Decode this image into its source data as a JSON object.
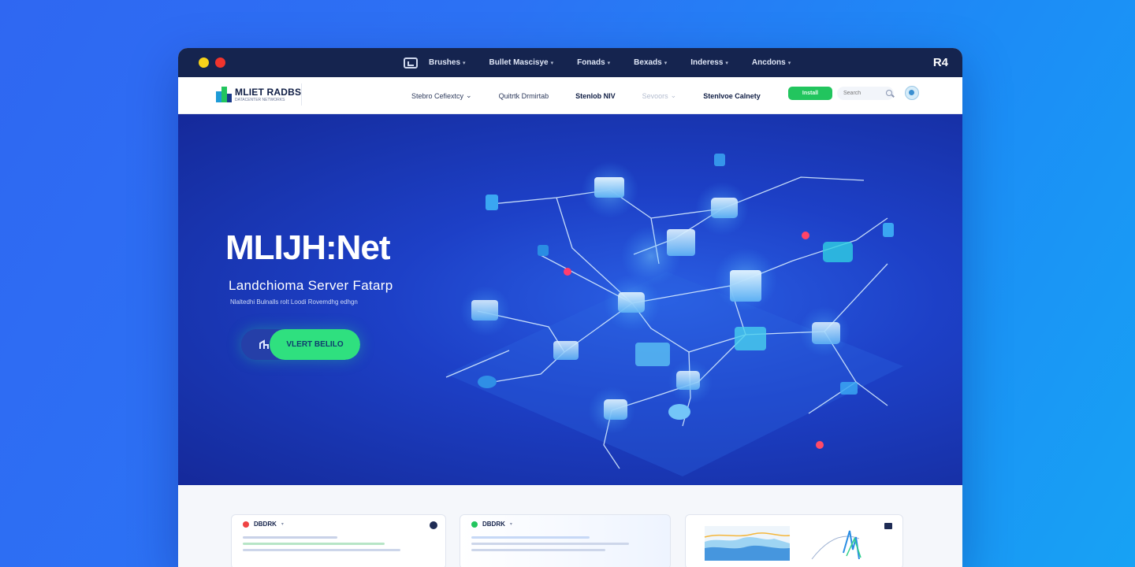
{
  "window": {
    "dots": [
      {
        "color": "#f7d21a"
      },
      {
        "color": "#f0342d"
      }
    ],
    "menu": [
      "Brushes",
      "Bullet Mascisye",
      "Fonads",
      "Bexads",
      "Inderess",
      "Ancdons"
    ],
    "right_label": "R4"
  },
  "navbar": {
    "logo_title": "MLIET RADBS",
    "logo_subtitle": "DATACENTER NETWORKS",
    "links": [
      {
        "label": "Stebro Cefiextcy",
        "chevron": "⌄"
      },
      {
        "label": "Quitrtk Drmirtab",
        "chevron": ""
      },
      {
        "label": "Stenlob NIV",
        "chevron": ""
      },
      {
        "label": "Sevoors",
        "chevron": "⌄"
      },
      {
        "label": "Stenlvoe Calnety",
        "chevron": ""
      }
    ],
    "cta_label": "Install",
    "search_placeholder": "Search"
  },
  "hero": {
    "title": "MLIJH:Net",
    "subtitle": "Landchioma Server Fatarp",
    "note": "Nlaltedhi Bulnalls rolt Loodi Rovemdhg edhgn",
    "button_label": "VLERT BELILO"
  },
  "cards": [
    {
      "title": "DBDRK",
      "status_color": "#ef4444"
    },
    {
      "title": "DBDRK",
      "status_color": "#22c55e"
    },
    {
      "title": "",
      "status_color": ""
    }
  ],
  "colors": {
    "accent_green": "#2fe07f",
    "hero_blue": "#1d40c7",
    "titlebar": "#15244f"
  }
}
